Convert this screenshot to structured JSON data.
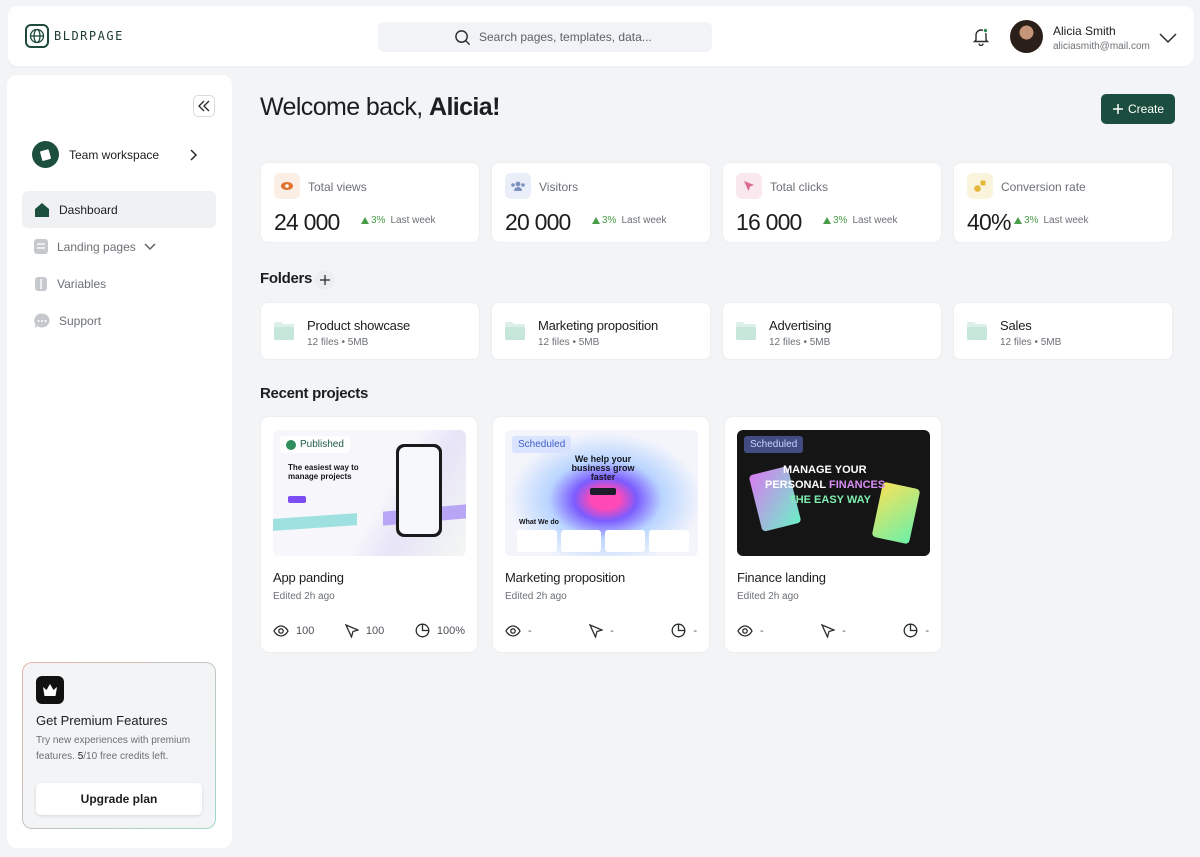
{
  "brand": {
    "name": "BLDRPAGE"
  },
  "search": {
    "placeholder": "Search pages, templates, data..."
  },
  "user": {
    "name": "Alicia Smith",
    "email": "aliciasmith@mail.com"
  },
  "sidebar": {
    "workspace": "Team workspace",
    "items": [
      {
        "label": "Dashboard",
        "icon": "home-icon",
        "active": true
      },
      {
        "label": "Landing pages",
        "icon": "document-icon"
      },
      {
        "label": "Variables",
        "icon": "variables-icon"
      },
      {
        "label": "Support",
        "icon": "chat-icon"
      }
    ],
    "premium": {
      "title": "Get Premium Features",
      "desc_prefix": "Try new experiences with premium features. ",
      "credits_used": "5",
      "credits_rest": "/10 free credits left.",
      "button": "Upgrade plan"
    }
  },
  "main": {
    "welcome_prefix": "Welcome back, ",
    "welcome_name": "Alicia!",
    "create_label": "Create",
    "stats": [
      {
        "label": "Total views",
        "value": "24 000",
        "delta": "3%",
        "period": "Last week",
        "icon": "eye-icon",
        "icon_bg": "#fbeee4",
        "icon_color": "#e0732f"
      },
      {
        "label": "Visitors",
        "value": "20 000",
        "delta": "3%",
        "period": "Last week",
        "icon": "users-icon",
        "icon_bg": "#e9eef8",
        "icon_color": "#7b90c0"
      },
      {
        "label": "Total clicks",
        "value": "16 000",
        "delta": "3%",
        "period": "Last week",
        "icon": "cursor-icon",
        "icon_bg": "#f9e8ee",
        "icon_color": "#d96b8c"
      },
      {
        "label": "Conversion rate",
        "value": "40%",
        "delta": "3%",
        "period": "Last week",
        "icon": "chart-icon",
        "icon_bg": "#fbf4dd",
        "icon_color": "#e4b73a"
      }
    ],
    "folders_title": "Folders",
    "folders": [
      {
        "name": "Product showcase",
        "meta": "12 files • 5MB"
      },
      {
        "name": "Marketing proposition",
        "meta": "12 files • 5MB"
      },
      {
        "name": "Advertising",
        "meta": "12 files • 5MB"
      },
      {
        "name": "Sales",
        "meta": "12 files • 5MB"
      }
    ],
    "projects_title": "Recent projects",
    "projects": [
      {
        "name": "App panding",
        "edited": "Edited 2h ago",
        "status": "Published",
        "views": "100",
        "clicks": "100",
        "conversion": "100%",
        "headline": "The easiest way to manage projects"
      },
      {
        "name": "Marketing proposition",
        "edited": "Edited 2h ago",
        "status": "Scheduled",
        "views": "-",
        "clicks": "-",
        "conversion": "-",
        "headline": "We help your business grow faster",
        "subhead": "What We do"
      },
      {
        "name": "Finance landing",
        "edited": "Edited 2h ago",
        "status": "Scheduled",
        "views": "-",
        "clicks": "-",
        "conversion": "-",
        "headline1": "MANAGE YOUR",
        "headline2a": "PERSONAL ",
        "headline2b": "FINANCES",
        "headline3": "THE EASY WAY"
      }
    ]
  },
  "colors": {
    "accent": "#1b4e3e",
    "positive": "#4a9e48",
    "background": "#f2f4f6"
  }
}
